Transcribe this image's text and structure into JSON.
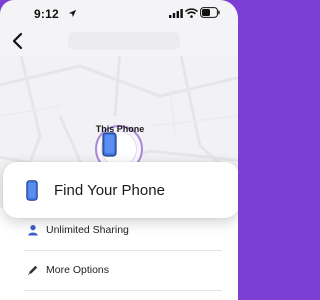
{
  "status_bar": {
    "time": "9:12",
    "location_icon": "location-arrow-icon",
    "signal_icon": "cellular-signal-icon",
    "wifi_icon": "wifi-icon",
    "battery_icon": "battery-icon"
  },
  "nav": {
    "back_icon": "chevron-left-icon"
  },
  "device": {
    "label": "This Phone",
    "icon": "smartphone-icon"
  },
  "actions": {
    "find_label": "Find Your Phone",
    "items": [
      {
        "label": "Unlimited Sharing",
        "icon": "person-icon"
      },
      {
        "label": "More Options",
        "icon": "pencil-icon"
      }
    ]
  },
  "colors": {
    "accent": "#7b3fd6",
    "device_blue": "#3f78e0",
    "ring": "#a98ad9"
  }
}
